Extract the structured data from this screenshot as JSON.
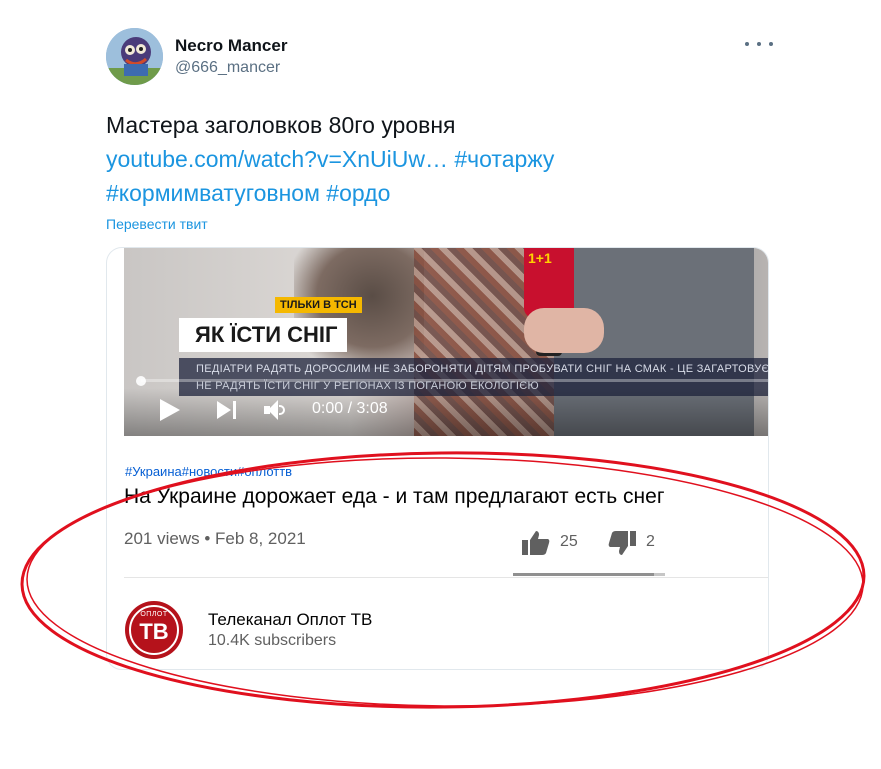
{
  "tweet": {
    "author_name": "Necro Mancer",
    "author_handle": "@666_mancer",
    "more_icon": "more-horizontal-icon",
    "text": "Мастера заголовков 80го уровня",
    "link": "youtube.com/watch?v=XnUiUw…",
    "hashtags": [
      "#чотаржу",
      "#кормимватуговном",
      "#ордо"
    ],
    "translate_label": "Перевести твит"
  },
  "video": {
    "badge": "ТІЛЬКИ В ТСН",
    "overlay_title": "ЯК ЇСТИ СНІГ",
    "ticker_line1": "ПЕДІАТРИ РАДЯТЬ ДОРОСЛИМ НЕ ЗАБОРОНЯТИ ДІТЯМ ПРОБУВАТИ СНІГ НА СМАК - ЦЕ ЗАГАРТОВУЄ ОРГА",
    "ticker_line2": "НЕ РАДЯТЬ ЇСТИ СНІГ У РЕГІОНАХ ІЗ ПОГАНОЮ ЕКОЛОГІЄЮ",
    "mic_label": "1+1",
    "time": "0:00 / 3:08",
    "progress": 0,
    "hashtags": [
      "#Украина",
      "#новости",
      "#оплоттв"
    ],
    "title": "На Украине дорожает еда - и там предлагают есть снег",
    "views": "201 views • Feb 8, 2021",
    "likes": "25",
    "dislikes": "2",
    "like_ratio": 0.93,
    "channel_logo_top": "ОПЛОТ",
    "channel_logo_main": "ТВ",
    "channel_name": "Телеканал Оплот ТВ",
    "subscribers": "10.4K subscribers"
  },
  "colors": {
    "link": "#1b95e0",
    "annotation": "#e0101e",
    "channel": "#b5121b"
  }
}
